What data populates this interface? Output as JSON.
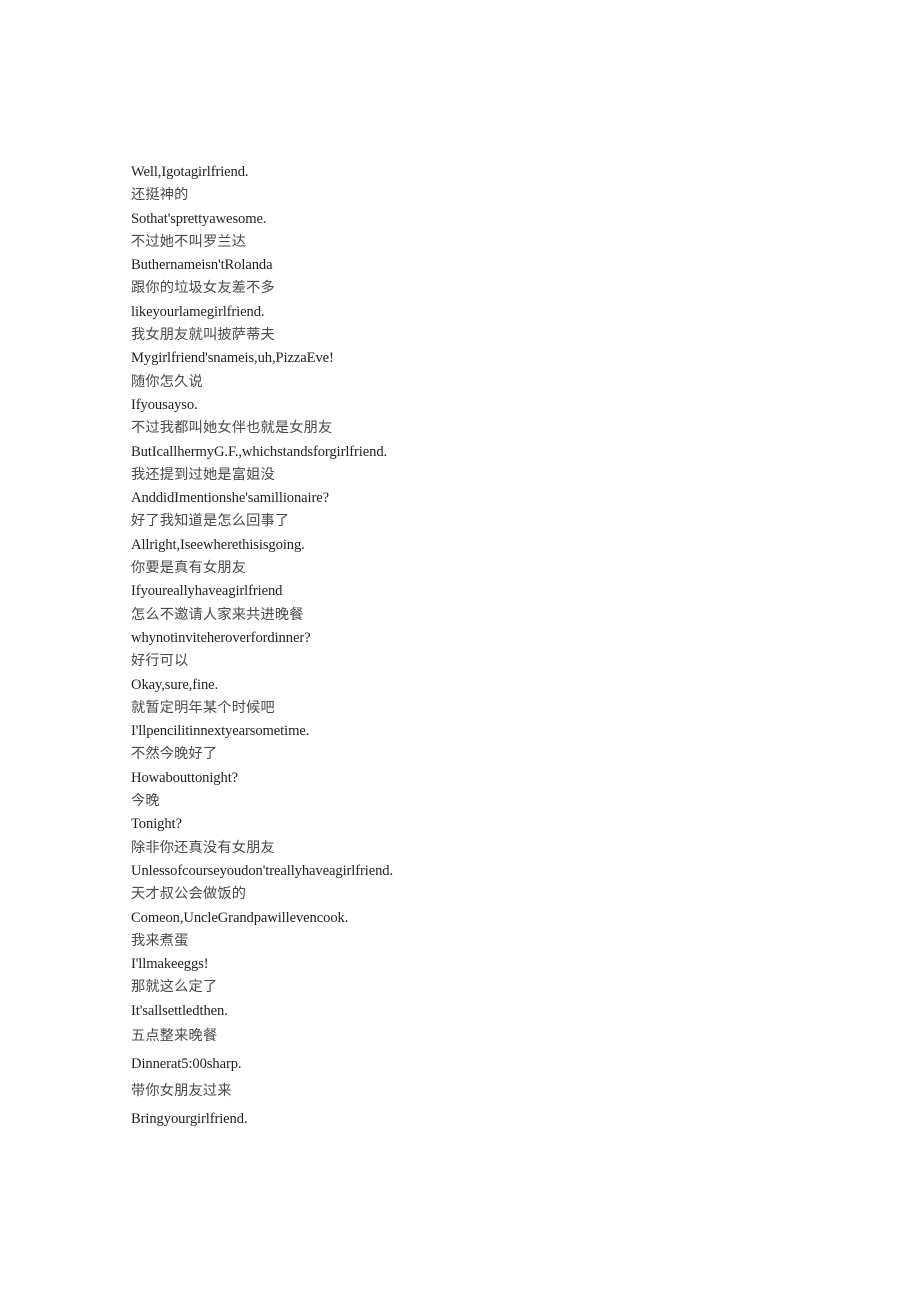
{
  "document": {
    "type": "bilingual-subtitle-transcript",
    "background_color": "#ffffff",
    "english_text_color": "#231f20",
    "chinese_text_color": "#4a4a4a",
    "lines": [
      {
        "lang": "en",
        "text": "Well,Igotagirlfriend."
      },
      {
        "lang": "zh",
        "text": "还挺神的"
      },
      {
        "lang": "en",
        "text": "Sothat'sprettyawesome."
      },
      {
        "lang": "zh",
        "text": "不过她不叫罗兰达"
      },
      {
        "lang": "en",
        "text": "Buthernameisn'tRolanda"
      },
      {
        "lang": "zh",
        "text": "跟你的垃圾女友差不多"
      },
      {
        "lang": "en",
        "text": "likeyourlamegirlfriend."
      },
      {
        "lang": "zh",
        "text": "我女朋友就叫披萨蒂夫"
      },
      {
        "lang": "en",
        "text": "Mygirlfriend'snameis,uh,PizzaEve!"
      },
      {
        "lang": "zh",
        "text": "随你怎久说"
      },
      {
        "lang": "en",
        "text": "Ifyousayso."
      },
      {
        "lang": "zh",
        "text": "不过我都叫她女伴也就是女朋友"
      },
      {
        "lang": "en",
        "text": "ButIcallhermyG.F.,whichstandsforgirlfriend."
      },
      {
        "lang": "zh",
        "text": "我还提到过她是富姐没"
      },
      {
        "lang": "en",
        "text": "AnddidImentionshe'samillionaire?"
      },
      {
        "lang": "zh",
        "text": "好了我知道是怎么回事了"
      },
      {
        "lang": "en",
        "text": "Allright,Iseewherethisisgoing."
      },
      {
        "lang": "zh",
        "text": "你要是真有女朋友"
      },
      {
        "lang": "en",
        "text": "Ifyoureallyhaveagirlfriend"
      },
      {
        "lang": "zh",
        "text": "怎么不邀请人家来共进晚餐"
      },
      {
        "lang": "en",
        "text": "whynotinviteheroverfordinner?"
      },
      {
        "lang": "zh",
        "text": "好行可以"
      },
      {
        "lang": "en",
        "text": "Okay,sure,fine."
      },
      {
        "lang": "zh",
        "text": "就暂定明年某个时候吧"
      },
      {
        "lang": "en",
        "text": "I'llpencilitinnextyearsometime."
      },
      {
        "lang": "zh",
        "text": "不然今晚好了"
      },
      {
        "lang": "en",
        "text": "Howabouttonight?"
      },
      {
        "lang": "zh",
        "text": "今晚"
      },
      {
        "lang": "en",
        "text": "Tonight?"
      },
      {
        "lang": "zh",
        "text": "除非你还真没有女朋友"
      },
      {
        "lang": "en",
        "text": "Unlessofcourseyoudon'treallyhaveagirlfriend."
      },
      {
        "lang": "zh",
        "text": "天才叔公会做饭的"
      },
      {
        "lang": "en",
        "text": "Comeon,UncleGrandpawillevencook."
      },
      {
        "lang": "zh",
        "text": "我来煮蛋"
      },
      {
        "lang": "en",
        "text": "I'llmakeeggs!"
      },
      {
        "lang": "zh",
        "text": "那就这么定了"
      },
      {
        "lang": "en",
        "text": "It'sallsettledthen."
      },
      {
        "lang": "zh",
        "text": "五点整来晚餐",
        "loose": true
      },
      {
        "lang": "en",
        "text": "Dinnerat5:00sharp.",
        "loose": true
      },
      {
        "lang": "zh",
        "text": "带你女朋友过来",
        "loose": true
      },
      {
        "lang": "en",
        "text": "Bringyourgirlfriend.",
        "loose": true
      }
    ]
  }
}
